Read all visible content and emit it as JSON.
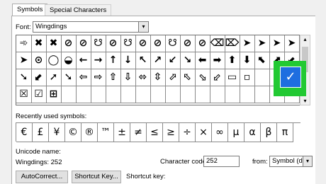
{
  "tabs": {
    "symbols": "Symbols",
    "special": "Special Characters"
  },
  "font": {
    "label": "Font:",
    "value": "Wingdings"
  },
  "icons": {
    "dropdown": "▾",
    "scroll_up": "▴",
    "scroll_down": "▾"
  },
  "grid": {
    "rows": [
      [
        "➾",
        "✖",
        "✖",
        "⊘",
        "⊘",
        "☋",
        "⊘",
        "☋",
        "⊘",
        "⊘",
        "☋",
        "⊘",
        "⊘",
        "⌫",
        "⌦",
        "➤",
        "➤",
        "➤",
        "➤"
      ],
      [
        "➤",
        "⊙",
        "◯",
        "◒",
        "←",
        "→",
        "↑",
        "↓",
        "↖",
        "↗",
        "↙",
        "↘",
        "⬅",
        "➡",
        "⬆",
        "⬇",
        "⬉",
        "⬈",
        "⬋"
      ],
      [
        "➘",
        "⬋",
        "➚",
        "➘",
        "⇦",
        "⇨",
        "⇧",
        "⇩",
        "⬄",
        "⇳",
        "⬀",
        "⬁",
        "⬂",
        "⬃",
        "▭",
        "▫",
        "",
        "",
        ""
      ],
      [
        "☒",
        "☑",
        "⊞",
        "",
        "",
        "",
        "",
        "",
        "",
        "",
        "",
        "",
        "",
        "",
        "",
        "",
        "",
        "",
        ""
      ]
    ]
  },
  "selected_symbol": "✓",
  "recent": {
    "label": "Recently used symbols:",
    "symbols": [
      "€",
      "£",
      "¥",
      "©",
      "®",
      "™",
      "±",
      "≠",
      "≤",
      "≥",
      "÷",
      "×",
      "∞",
      "μ",
      "α",
      "β",
      "π"
    ]
  },
  "unicode": {
    "label": "Unicode name:",
    "value": "Wingdings: 252"
  },
  "character_code": {
    "label": "Character code:",
    "value": "252"
  },
  "from": {
    "label": "from:",
    "value": "Symbol (decimal)"
  },
  "buttons": {
    "autocorrect": "AutoCorrect...",
    "shortcut_key": "Shortcut Key...",
    "shortcut_key_label": "Shortcut key:"
  }
}
